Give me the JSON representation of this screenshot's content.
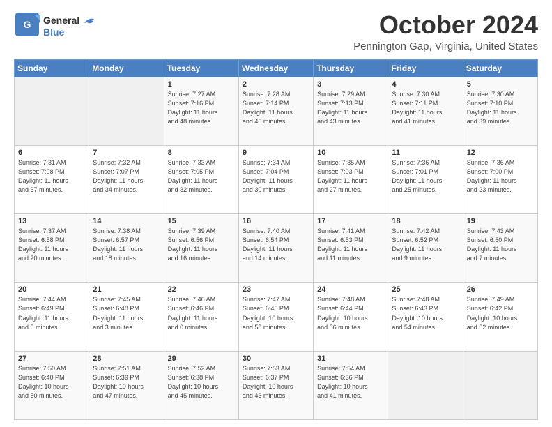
{
  "logo": {
    "line1": "General",
    "line2": "Blue"
  },
  "header": {
    "month": "October 2024",
    "location": "Pennington Gap, Virginia, United States"
  },
  "weekdays": [
    "Sunday",
    "Monday",
    "Tuesday",
    "Wednesday",
    "Thursday",
    "Friday",
    "Saturday"
  ],
  "weeks": [
    [
      {
        "day": "",
        "info": ""
      },
      {
        "day": "",
        "info": ""
      },
      {
        "day": "1",
        "info": "Sunrise: 7:27 AM\nSunset: 7:16 PM\nDaylight: 11 hours\nand 48 minutes."
      },
      {
        "day": "2",
        "info": "Sunrise: 7:28 AM\nSunset: 7:14 PM\nDaylight: 11 hours\nand 46 minutes."
      },
      {
        "day": "3",
        "info": "Sunrise: 7:29 AM\nSunset: 7:13 PM\nDaylight: 11 hours\nand 43 minutes."
      },
      {
        "day": "4",
        "info": "Sunrise: 7:30 AM\nSunset: 7:11 PM\nDaylight: 11 hours\nand 41 minutes."
      },
      {
        "day": "5",
        "info": "Sunrise: 7:30 AM\nSunset: 7:10 PM\nDaylight: 11 hours\nand 39 minutes."
      }
    ],
    [
      {
        "day": "6",
        "info": "Sunrise: 7:31 AM\nSunset: 7:08 PM\nDaylight: 11 hours\nand 37 minutes."
      },
      {
        "day": "7",
        "info": "Sunrise: 7:32 AM\nSunset: 7:07 PM\nDaylight: 11 hours\nand 34 minutes."
      },
      {
        "day": "8",
        "info": "Sunrise: 7:33 AM\nSunset: 7:05 PM\nDaylight: 11 hours\nand 32 minutes."
      },
      {
        "day": "9",
        "info": "Sunrise: 7:34 AM\nSunset: 7:04 PM\nDaylight: 11 hours\nand 30 minutes."
      },
      {
        "day": "10",
        "info": "Sunrise: 7:35 AM\nSunset: 7:03 PM\nDaylight: 11 hours\nand 27 minutes."
      },
      {
        "day": "11",
        "info": "Sunrise: 7:36 AM\nSunset: 7:01 PM\nDaylight: 11 hours\nand 25 minutes."
      },
      {
        "day": "12",
        "info": "Sunrise: 7:36 AM\nSunset: 7:00 PM\nDaylight: 11 hours\nand 23 minutes."
      }
    ],
    [
      {
        "day": "13",
        "info": "Sunrise: 7:37 AM\nSunset: 6:58 PM\nDaylight: 11 hours\nand 20 minutes."
      },
      {
        "day": "14",
        "info": "Sunrise: 7:38 AM\nSunset: 6:57 PM\nDaylight: 11 hours\nand 18 minutes."
      },
      {
        "day": "15",
        "info": "Sunrise: 7:39 AM\nSunset: 6:56 PM\nDaylight: 11 hours\nand 16 minutes."
      },
      {
        "day": "16",
        "info": "Sunrise: 7:40 AM\nSunset: 6:54 PM\nDaylight: 11 hours\nand 14 minutes."
      },
      {
        "day": "17",
        "info": "Sunrise: 7:41 AM\nSunset: 6:53 PM\nDaylight: 11 hours\nand 11 minutes."
      },
      {
        "day": "18",
        "info": "Sunrise: 7:42 AM\nSunset: 6:52 PM\nDaylight: 11 hours\nand 9 minutes."
      },
      {
        "day": "19",
        "info": "Sunrise: 7:43 AM\nSunset: 6:50 PM\nDaylight: 11 hours\nand 7 minutes."
      }
    ],
    [
      {
        "day": "20",
        "info": "Sunrise: 7:44 AM\nSunset: 6:49 PM\nDaylight: 11 hours\nand 5 minutes."
      },
      {
        "day": "21",
        "info": "Sunrise: 7:45 AM\nSunset: 6:48 PM\nDaylight: 11 hours\nand 3 minutes."
      },
      {
        "day": "22",
        "info": "Sunrise: 7:46 AM\nSunset: 6:46 PM\nDaylight: 11 hours\nand 0 minutes."
      },
      {
        "day": "23",
        "info": "Sunrise: 7:47 AM\nSunset: 6:45 PM\nDaylight: 10 hours\nand 58 minutes."
      },
      {
        "day": "24",
        "info": "Sunrise: 7:48 AM\nSunset: 6:44 PM\nDaylight: 10 hours\nand 56 minutes."
      },
      {
        "day": "25",
        "info": "Sunrise: 7:48 AM\nSunset: 6:43 PM\nDaylight: 10 hours\nand 54 minutes."
      },
      {
        "day": "26",
        "info": "Sunrise: 7:49 AM\nSunset: 6:42 PM\nDaylight: 10 hours\nand 52 minutes."
      }
    ],
    [
      {
        "day": "27",
        "info": "Sunrise: 7:50 AM\nSunset: 6:40 PM\nDaylight: 10 hours\nand 50 minutes."
      },
      {
        "day": "28",
        "info": "Sunrise: 7:51 AM\nSunset: 6:39 PM\nDaylight: 10 hours\nand 47 minutes."
      },
      {
        "day": "29",
        "info": "Sunrise: 7:52 AM\nSunset: 6:38 PM\nDaylight: 10 hours\nand 45 minutes."
      },
      {
        "day": "30",
        "info": "Sunrise: 7:53 AM\nSunset: 6:37 PM\nDaylight: 10 hours\nand 43 minutes."
      },
      {
        "day": "31",
        "info": "Sunrise: 7:54 AM\nSunset: 6:36 PM\nDaylight: 10 hours\nand 41 minutes."
      },
      {
        "day": "",
        "info": ""
      },
      {
        "day": "",
        "info": ""
      }
    ]
  ]
}
